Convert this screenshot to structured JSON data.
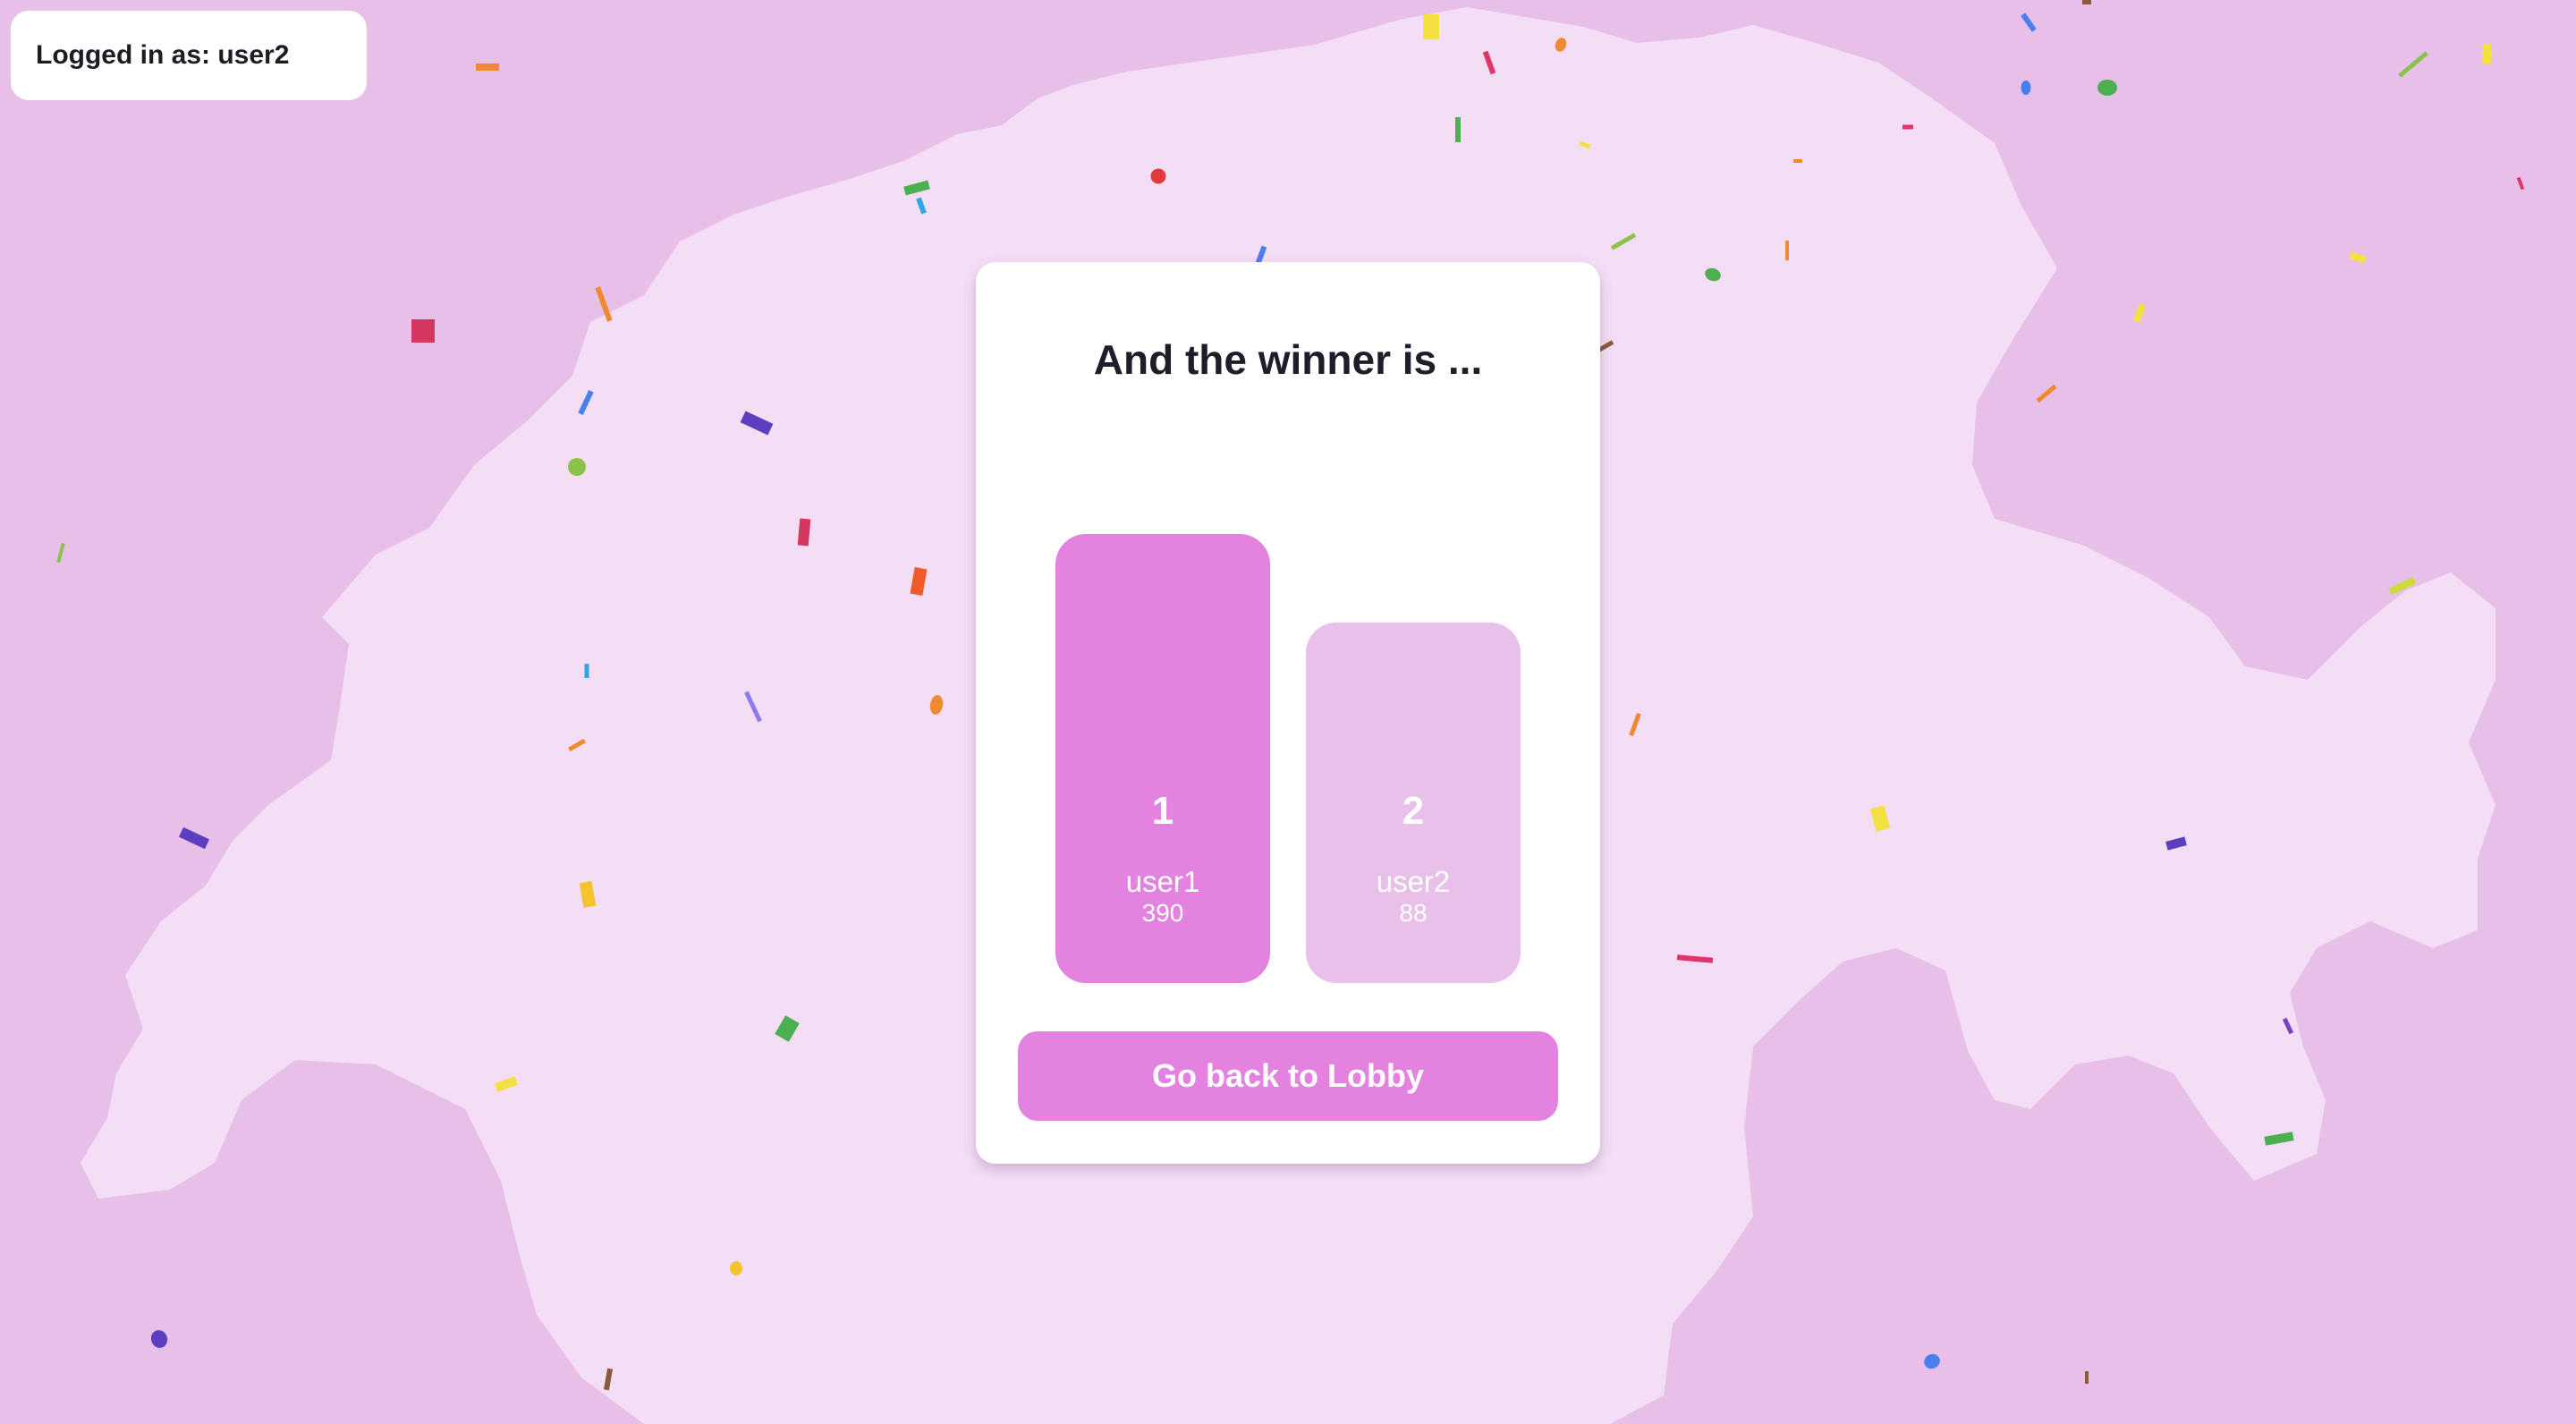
{
  "header": {
    "login_status": "Logged in as: user2"
  },
  "results": {
    "title": "And the winner is ...",
    "podium": [
      {
        "rank": "1",
        "name": "user1",
        "score": "390"
      },
      {
        "rank": "2",
        "name": "user2",
        "score": "88"
      }
    ],
    "back_button_label": "Go back to Lobby"
  },
  "colors": {
    "background": "#e8bfe9",
    "map_fill": "#f4def6",
    "accent": "#e383df",
    "accent_light": "#e9c0ea",
    "text_dark": "#1e1d2a"
  },
  "icons": {
    "map": "switzerland-map-icon",
    "decoration": "confetti"
  }
}
